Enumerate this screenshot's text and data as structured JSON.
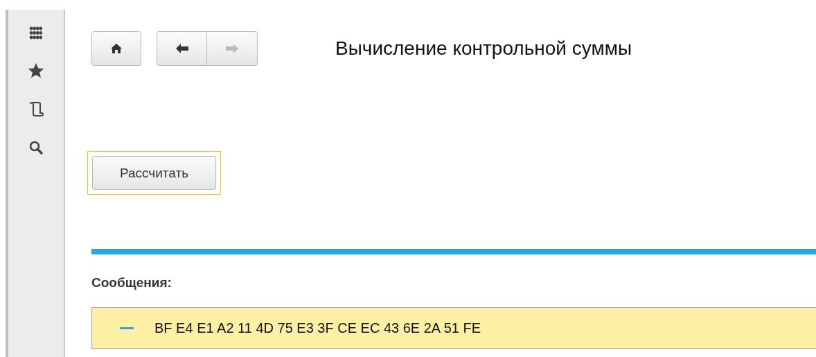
{
  "sidebar": {
    "items": [
      {
        "kind": "apps"
      },
      {
        "kind": "favorites"
      },
      {
        "kind": "history"
      },
      {
        "kind": "search"
      }
    ]
  },
  "nav": {
    "back_disabled": false,
    "forward_disabled": true
  },
  "form": {
    "title": "Вычисление контрольной суммы",
    "button": {
      "label": "Рассчитать",
      "focused": true
    }
  },
  "messages": {
    "title": "Сообщения:",
    "items": [
      {
        "text": "BF E4 E1 A2 11 4D 75 E3 3F CE EC 43 6E 2A 51 FE"
      }
    ]
  }
}
